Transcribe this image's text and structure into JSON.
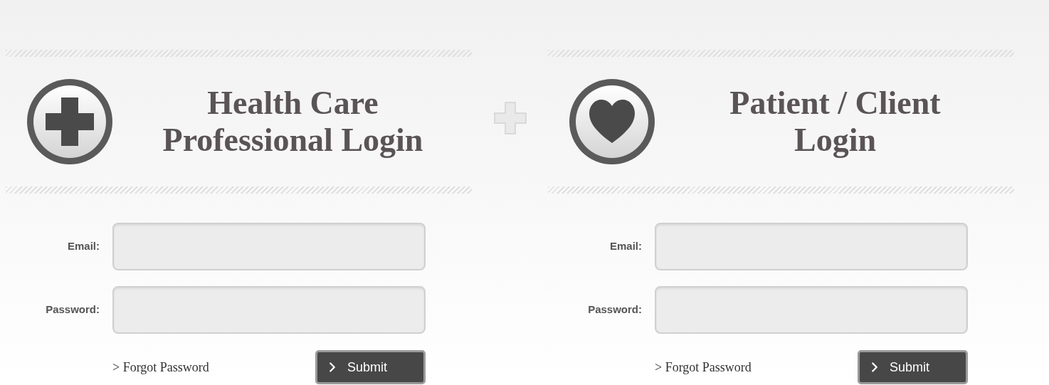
{
  "panels": [
    {
      "title_lines": [
        "Health Care",
        "Professional Login"
      ],
      "fields": [
        {
          "label": "Email:"
        },
        {
          "label": "Password:"
        }
      ],
      "forgot_link": "> Forgot Password",
      "submit": "Submit"
    },
    {
      "title_lines": [
        "Patient / Client",
        "Login"
      ],
      "fields": [
        {
          "label": "Email:"
        },
        {
          "label": "Password:"
        }
      ],
      "forgot_link": "> Forgot Password",
      "submit": "Submit"
    }
  ]
}
